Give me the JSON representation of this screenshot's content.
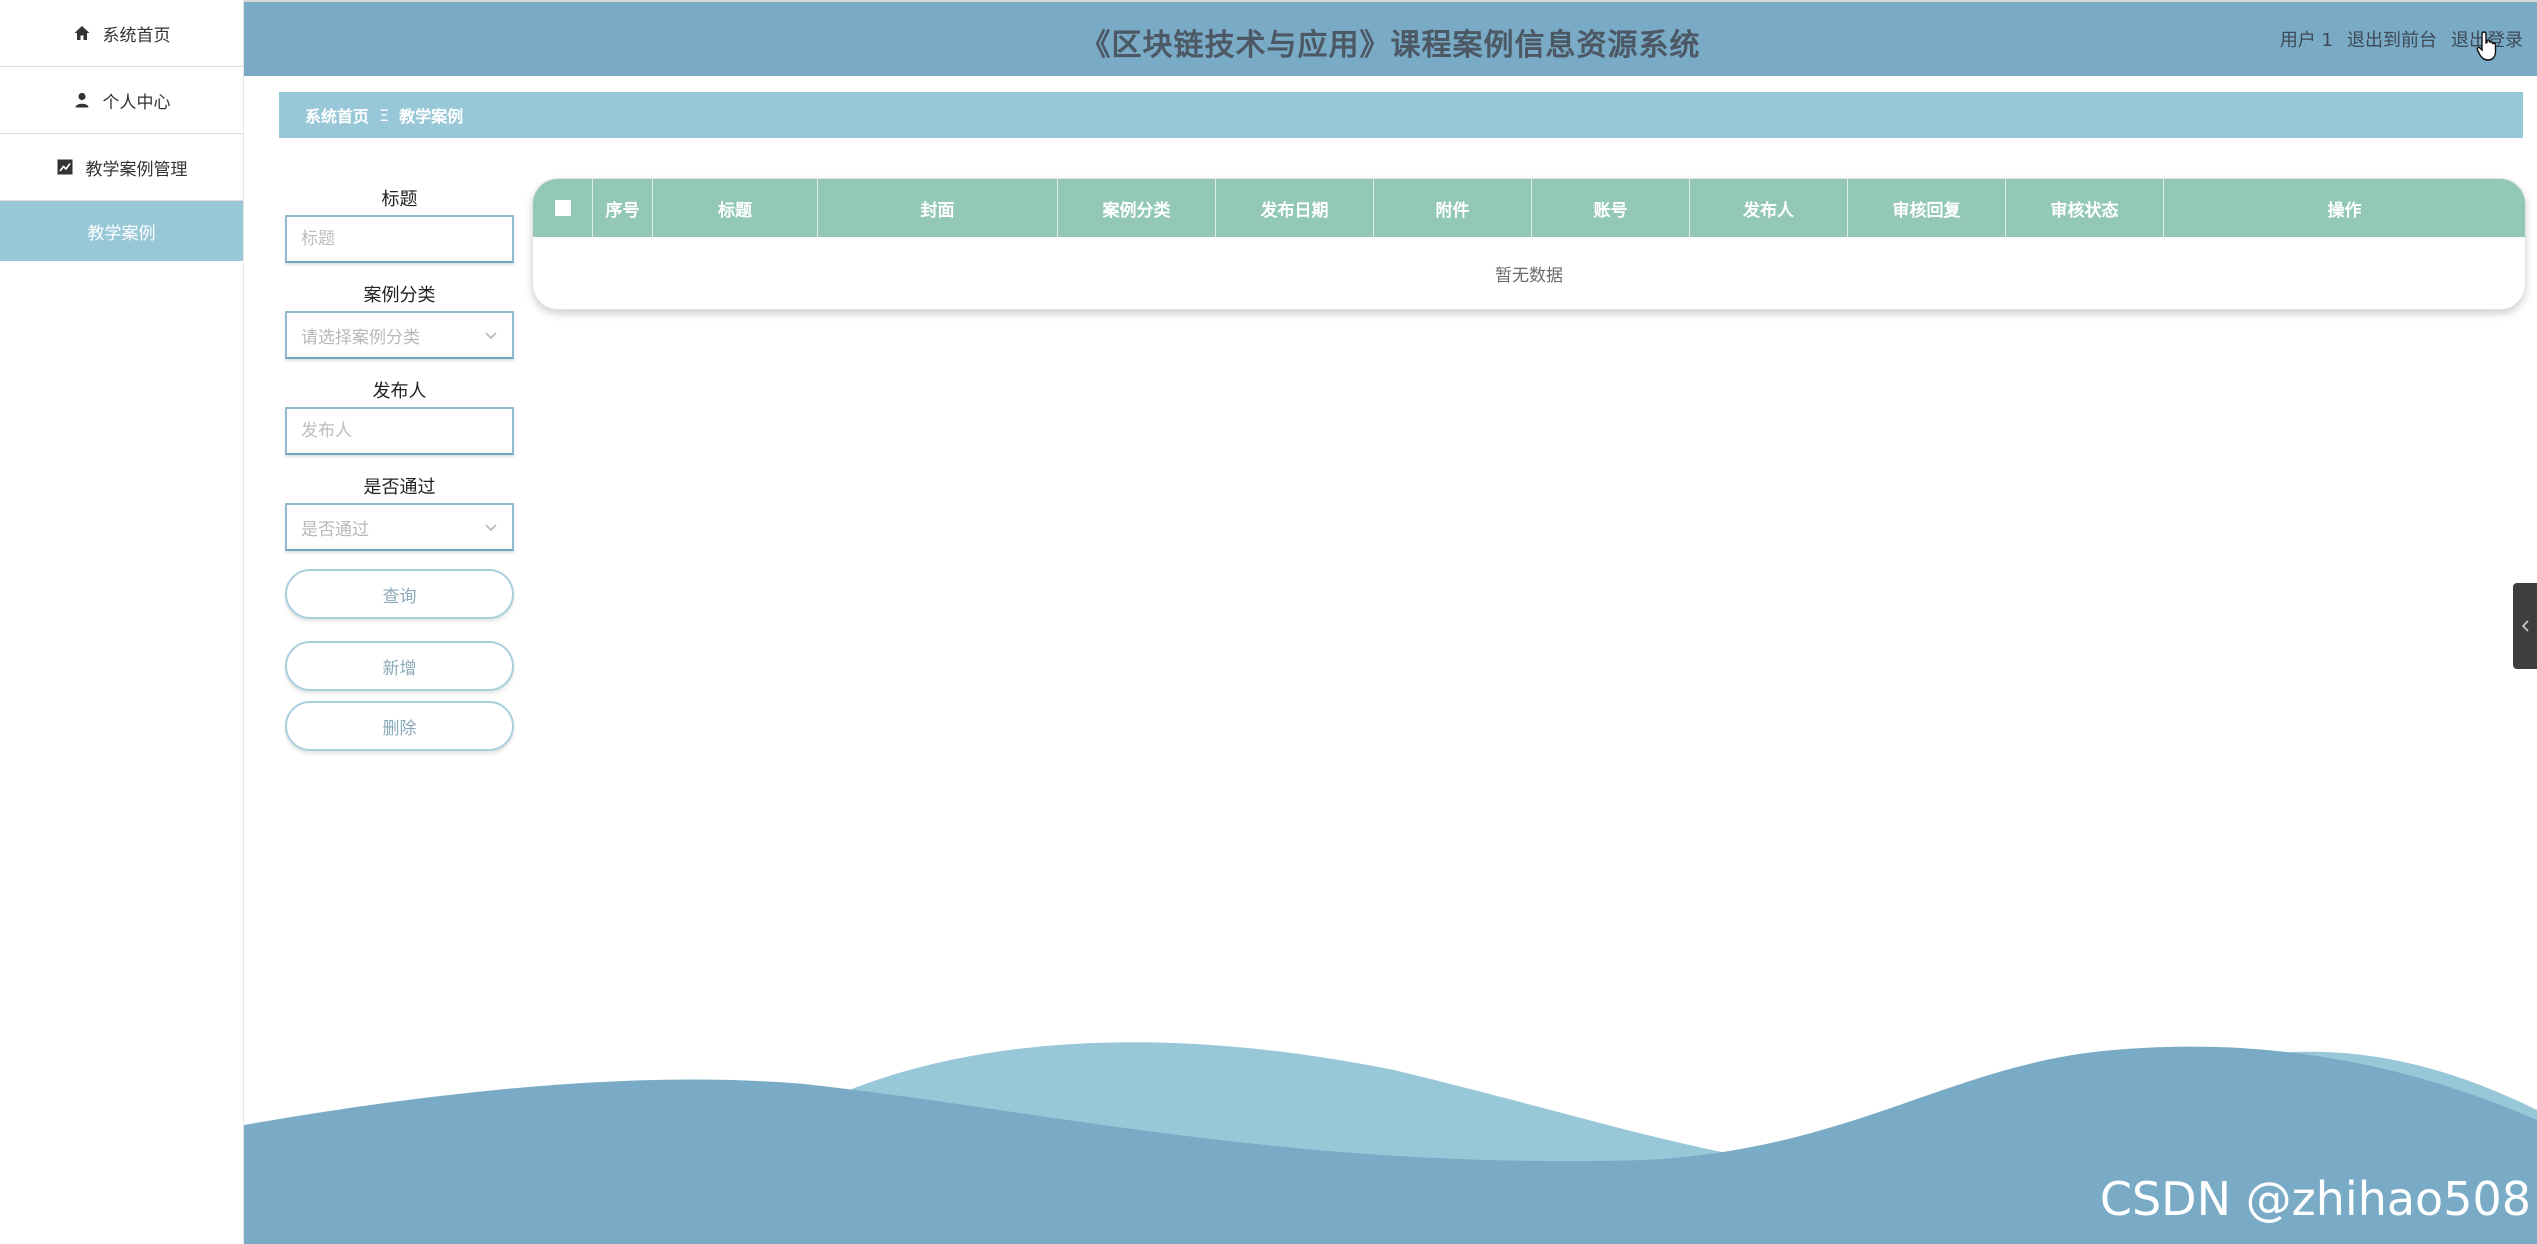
{
  "sidebar": {
    "items": [
      {
        "label": "系统首页",
        "icon": "home-icon"
      },
      {
        "label": "个人中心",
        "icon": "user-icon"
      },
      {
        "label": "教学案例管理",
        "icon": "chart-icon"
      }
    ],
    "sub_item": "教学案例"
  },
  "header": {
    "title": "《区块链技术与应用》课程案例信息资源系统",
    "user": "用户 1",
    "to_front": "退出到前台",
    "logout": "退出登录"
  },
  "breadcrumb": {
    "home": "系统首页",
    "separator": "Ξ",
    "current": "教学案例"
  },
  "search": {
    "title_label": "标题",
    "title_placeholder": "标题",
    "category_label": "案例分类",
    "category_placeholder": "请选择案例分类",
    "publisher_label": "发布人",
    "publisher_placeholder": "发布人",
    "pass_label": "是否通过",
    "pass_placeholder": "是否通过"
  },
  "buttons": {
    "query": "查询",
    "add": "新增",
    "delete": "删除"
  },
  "table": {
    "columns": [
      "序号",
      "标题",
      "封面",
      "案例分类",
      "发布日期",
      "附件",
      "账号",
      "发布人",
      "审核回复",
      "审核状态",
      "操作"
    ],
    "empty_text": "暂无数据"
  },
  "watermark": "CSDN @zhihao508",
  "colors": {
    "header": "#79abc6",
    "breadcrumb": "#98c8d8",
    "table_head": "#92c8b5",
    "wave_light": "#98c8d8",
    "wave_dark": "#79abc6"
  }
}
